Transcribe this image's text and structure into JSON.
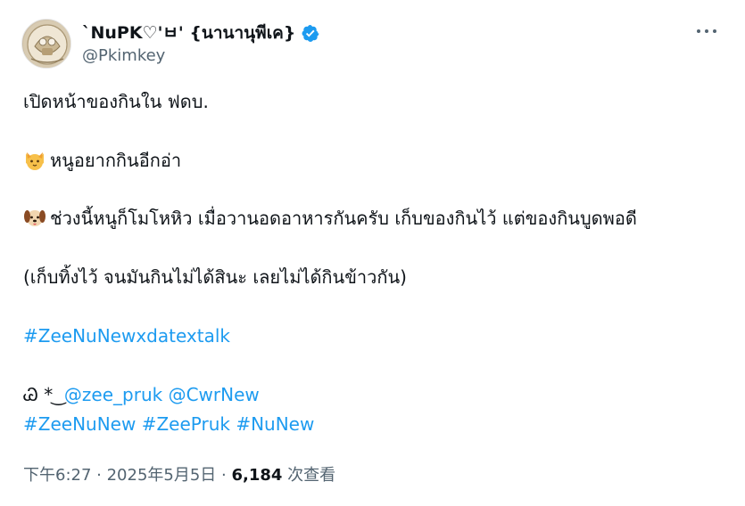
{
  "author": {
    "display_name": "`NuPK♡'ㅂ' {นานานุพีเค}",
    "handle": "@Pkimkey",
    "verified_icon": "verified-badge-icon",
    "avatar_icon": "avatar-image",
    "colors": {
      "verified": "#1d9bf0"
    }
  },
  "more_menu": {
    "icon": "more-horizontal-icon"
  },
  "tweet": {
    "line1": "เปิดหน้าของกินใน ฟดบ.",
    "line2": "หนูอยากกินอีกอ่า",
    "line2_emoji": "cat-face-icon",
    "line3": "ช่วงนี้หนูก็โมโหหิว เมื่อวานอดอาหารกันครับ เก็บของกินไว้ แต่ของกินบูดพอดี",
    "line3_emoji": "dog-face-icon",
    "line4": "(เก็บทิ้งไว้ จนมันกินไม่ได้สินะ เลยไม่ได้กินข้าวกัน)",
    "hashtag_main": "#ZeeNuNewxdatextalk",
    "mention_prefix": "Ꮚ * ͜ ",
    "mentions": [
      "@zee_pruk",
      "@CwrNew"
    ],
    "hashtags": [
      "#ZeeNuNew",
      "#ZeePruk",
      "#NuNew"
    ]
  },
  "meta": {
    "time": "下午6:27",
    "separator1": " · ",
    "date": "2025年5月5日",
    "separator2": " · ",
    "views_count": "6,184",
    "views_label": " 次查看"
  },
  "colors": {
    "link": "#1d9bf0",
    "text": "#0f1419",
    "secondary": "#536471"
  }
}
